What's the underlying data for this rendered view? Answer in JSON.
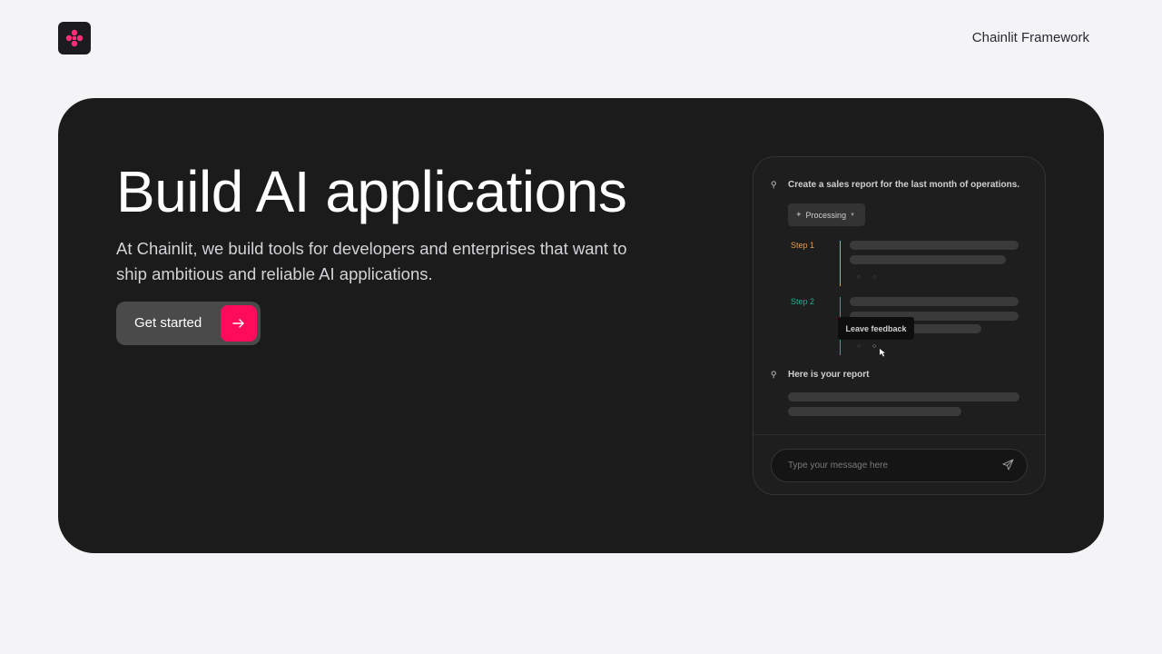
{
  "header": {
    "logo_icon": "chainlit-logo-icon",
    "nav_link": "Chainlit Framework"
  },
  "hero": {
    "title": "Build AI applications",
    "subtitle": "At Chainlit, we build tools for developers and enterprises that want to ship ambitious and reliable AI applications.",
    "cta_label": "Get started",
    "cta_icon": "arrow-right-icon"
  },
  "mockup": {
    "user_message": "Create a sales report for the last month of operations.",
    "processing_label": "Processing",
    "step1_label": "Step 1",
    "step2_label": "Step 2",
    "tooltip": "Leave feedback",
    "report_message": "Here is your report",
    "input_placeholder": "Type your message here"
  },
  "colors": {
    "accent": "#ff0b5b",
    "step1": "#e0a04a",
    "step2": "#1fae8f",
    "hero_bg": "#1b1b1b",
    "page_bg": "#f4f4f6"
  }
}
